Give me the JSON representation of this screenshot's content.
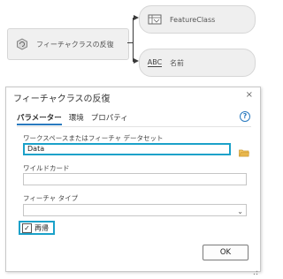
{
  "model": {
    "tool_node": {
      "label": "フィーチャクラスの反復",
      "icon": "iterate-icon"
    },
    "output_fc": {
      "label": "FeatureClass",
      "icon": "feature-class-icon"
    },
    "output_name": {
      "label": "名前",
      "badge": "ABC"
    }
  },
  "dialog": {
    "title": "フィーチャクラスの反復",
    "close": "×",
    "tabs": [
      "パラメーター",
      "環境",
      "プロパティ"
    ],
    "active_tab": "パラメーター",
    "help": "?",
    "params": {
      "workspace_label": "ワークスペースまたはフィーチャ データセット",
      "workspace_value": "Data",
      "wildcard_label": "ワイルドカード",
      "wildcard_value": "",
      "fctype_label": "フィーチャ タイプ",
      "fctype_value": "",
      "recursive_label": "再帰",
      "recursive_checked": true
    },
    "ok_label": "OK"
  },
  "colors": {
    "highlight": "#1ba1c9",
    "accent": "#2a7abf",
    "folder": "#e8b64c"
  }
}
